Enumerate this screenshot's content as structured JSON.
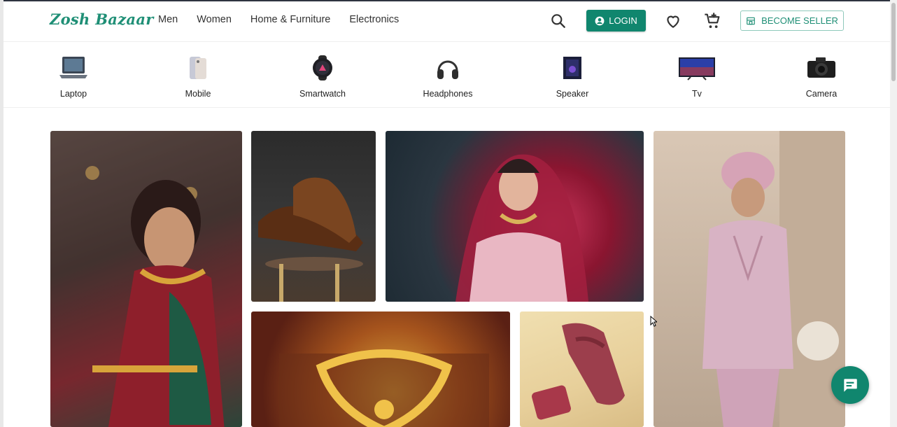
{
  "header": {
    "logo": "Zosh Bazaar",
    "nav": [
      "Men",
      "Women",
      "Home & Furniture",
      "Electronics"
    ],
    "login_label": "LOGIN",
    "seller_label": "BECOME SELLER"
  },
  "categories": [
    {
      "label": "Laptop",
      "icon": "laptop-icon"
    },
    {
      "label": "Mobile",
      "icon": "mobile-icon"
    },
    {
      "label": "Smartwatch",
      "icon": "smartwatch-icon"
    },
    {
      "label": "Headphones",
      "icon": "headphones-icon"
    },
    {
      "label": "Speaker",
      "icon": "speaker-icon"
    },
    {
      "label": "Tv",
      "icon": "tv-icon"
    },
    {
      "label": "Camera",
      "icon": "camera-icon"
    }
  ],
  "tiles": [
    "woman-saree-jewelry-photo",
    "brown-shoes-photo",
    "bridal-lehenga-photo",
    "man-sherwani-photo",
    "gold-jewelry-photo",
    "women-sandals-photo"
  ],
  "colors": {
    "brand": "#10866e",
    "brand_text": "#1f8f76",
    "seller_border": "#8fc9bb"
  }
}
